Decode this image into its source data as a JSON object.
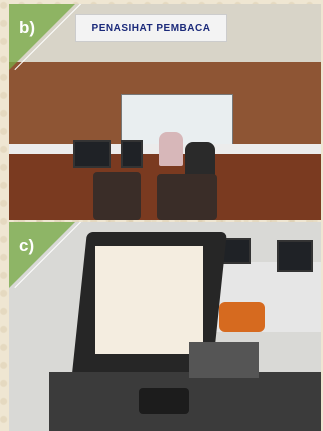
{
  "panels": [
    {
      "tag": "b)",
      "signage": "PENASIHAT PEMBACA"
    },
    {
      "tag": "c)"
    }
  ]
}
